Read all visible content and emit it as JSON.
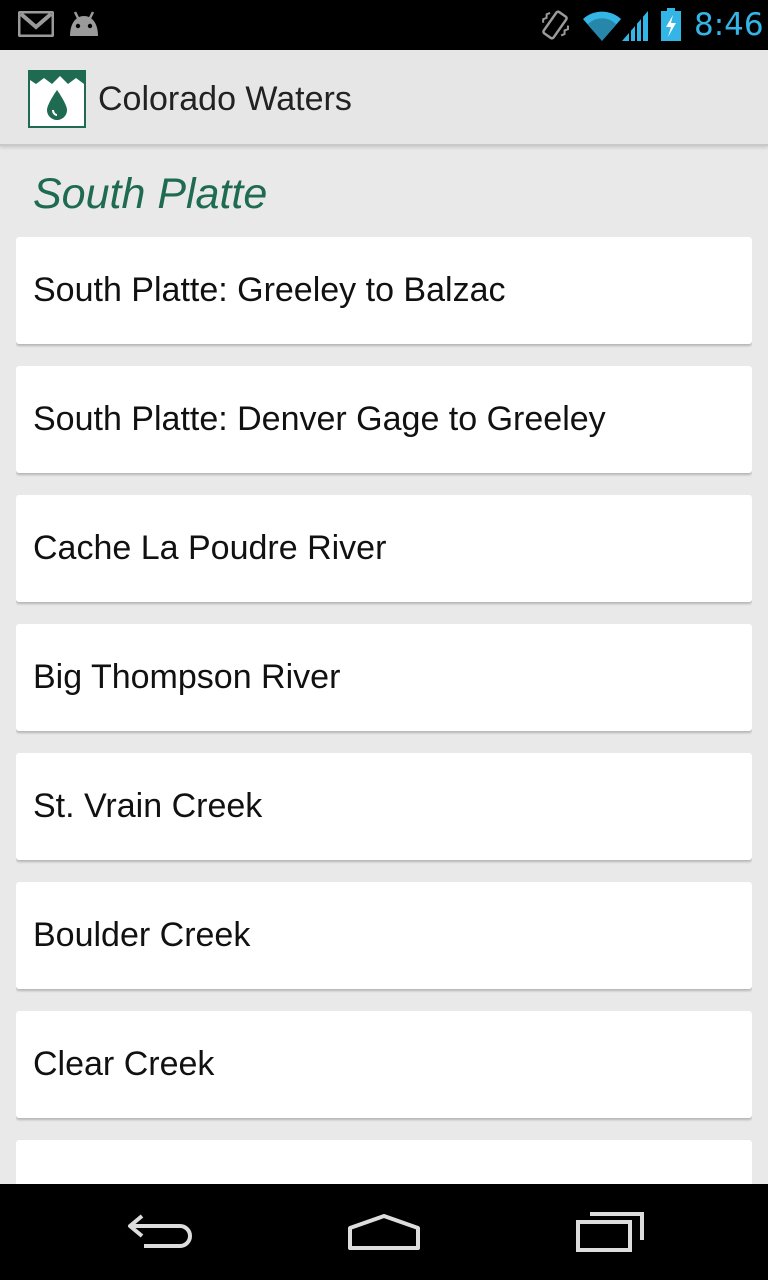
{
  "status_bar": {
    "time": "8:46",
    "icons": [
      "gmail-icon",
      "android-icon",
      "vibrate-icon",
      "wifi-icon",
      "signal-icon",
      "battery-charging-icon"
    ],
    "accent_color": "#33b5e5"
  },
  "action_bar": {
    "title": "Colorado Waters",
    "app_icon": "water-drop-icon"
  },
  "section": {
    "title": "South Platte",
    "title_color": "#1e6b52"
  },
  "items": [
    {
      "label": "South Platte: Greeley to Balzac"
    },
    {
      "label": "South Platte: Denver Gage to Greeley"
    },
    {
      "label": "Cache La Poudre River"
    },
    {
      "label": "Big Thompson River"
    },
    {
      "label": "St. Vrain Creek"
    },
    {
      "label": "Boulder Creek"
    },
    {
      "label": "Clear Creek"
    },
    {
      "label": ""
    }
  ],
  "nav_bar": {
    "buttons": [
      "back-icon",
      "home-icon",
      "recent-apps-icon"
    ]
  }
}
